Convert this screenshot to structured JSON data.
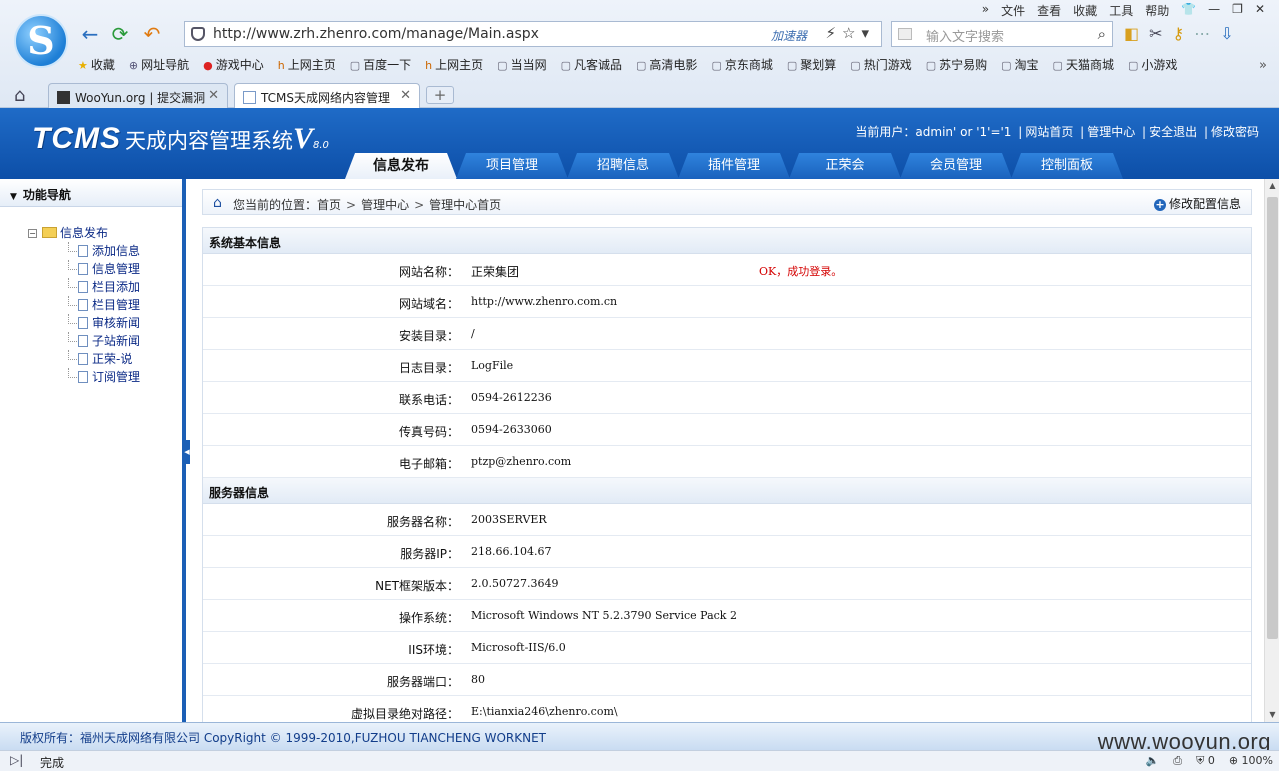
{
  "browser": {
    "menu": [
      "»",
      "文件",
      "查看",
      "收藏",
      "工具",
      "帮助",
      "👕",
      "—",
      "❐",
      "✕"
    ],
    "url": "http://www.zrh.zhenro.com/manage/Main.aspx",
    "accelerator_label": "加速器",
    "search_placeholder": "输入文字搜索",
    "favorites": [
      {
        "label": "收藏",
        "icon": "star-icon"
      },
      {
        "label": "网址导航",
        "icon": "globe-icon"
      },
      {
        "label": "游戏中心",
        "icon": "game-icon"
      },
      {
        "label": "上网主页",
        "icon": "hao-icon"
      },
      {
        "label": "百度一下",
        "icon": "page-icon"
      },
      {
        "label": "上网主页",
        "icon": "hao-icon"
      },
      {
        "label": "当当网",
        "icon": "page-icon"
      },
      {
        "label": "凡客诚品",
        "icon": "page-icon"
      },
      {
        "label": "高清电影",
        "icon": "page-icon"
      },
      {
        "label": "京东商城",
        "icon": "page-icon"
      },
      {
        "label": "聚划算",
        "icon": "page-icon"
      },
      {
        "label": "热门游戏",
        "icon": "page-icon"
      },
      {
        "label": "苏宁易购",
        "icon": "page-icon"
      },
      {
        "label": "淘宝",
        "icon": "page-icon"
      },
      {
        "label": "天猫商城",
        "icon": "page-icon"
      },
      {
        "label": "小游戏",
        "icon": "page-icon"
      }
    ],
    "favorites_more": "»",
    "tabs": [
      {
        "label": "WooYun.org | 提交漏洞",
        "active": false
      },
      {
        "label": "TCMS天成网络内容管理",
        "active": true
      }
    ],
    "newtab_label": "+"
  },
  "header": {
    "brand_tcms": "TCMS",
    "brand_name": "天成内容管理系统",
    "brand_version": "V",
    "brand_version_sub": "8.0",
    "user_prefix": "当前用户：admin' or '1'='1",
    "user_links": [
      "网站首页",
      "管理中心",
      "安全退出",
      "修改密码"
    ],
    "nav": [
      "信息发布",
      "项目管理",
      "招聘信息",
      "插件管理",
      "正荣会",
      "会员管理",
      "控制面板"
    ],
    "nav_active_index": 0
  },
  "sidebar": {
    "title": "功能导航",
    "root": "信息发布",
    "items": [
      "添加信息",
      "信息管理",
      "栏目添加",
      "栏目管理",
      "审核新闻",
      "子站新闻",
      "正荣-说",
      "订阅管理"
    ]
  },
  "breadcrumb": {
    "prefix": "您当前的位置：",
    "path": [
      "首页",
      "管理中心",
      "管理中心首页"
    ],
    "config_link": "修改配置信息"
  },
  "system_info": {
    "title": "系统基本信息",
    "login_message": "OK，成功登录。",
    "rows": [
      {
        "label": "网站名称：",
        "value": "正荣集团"
      },
      {
        "label": "网站域名：",
        "value": "http://www.zhenro.com.cn"
      },
      {
        "label": "安装目录：",
        "value": "/"
      },
      {
        "label": "日志目录：",
        "value": "LogFile"
      },
      {
        "label": "联系电话：",
        "value": "0594-2612236"
      },
      {
        "label": "传真号码：",
        "value": "0594-2633060"
      },
      {
        "label": "电子邮箱：",
        "value": "ptzp@zhenro.com"
      }
    ]
  },
  "server_info": {
    "title": "服务器信息",
    "rows": [
      {
        "label": "服务器名称：",
        "value": "2003SERVER"
      },
      {
        "label": "服务器IP：",
        "value": "218.66.104.67"
      },
      {
        "label": "NET框架版本：",
        "value": "2.0.50727.3649"
      },
      {
        "label": "操作系统：",
        "value": "Microsoft Windows NT 5.2.3790 Service Pack 2"
      },
      {
        "label": "IIS环境：",
        "value": "Microsoft-IIS/6.0"
      },
      {
        "label": "服务器端口：",
        "value": "80"
      },
      {
        "label": "虚拟目录绝对路径：",
        "value": "E:\\tianxia246\\zhenro.com\\"
      }
    ]
  },
  "footer": {
    "copyright": "版权所有：福州天成网络有限公司 CopyRight © 1999-2010,FUZHOU TIANCHENG WORKNET",
    "watermark": "www.wooyun.org"
  },
  "status": {
    "text": "完成",
    "counter": "0",
    "zoom": "100%"
  }
}
